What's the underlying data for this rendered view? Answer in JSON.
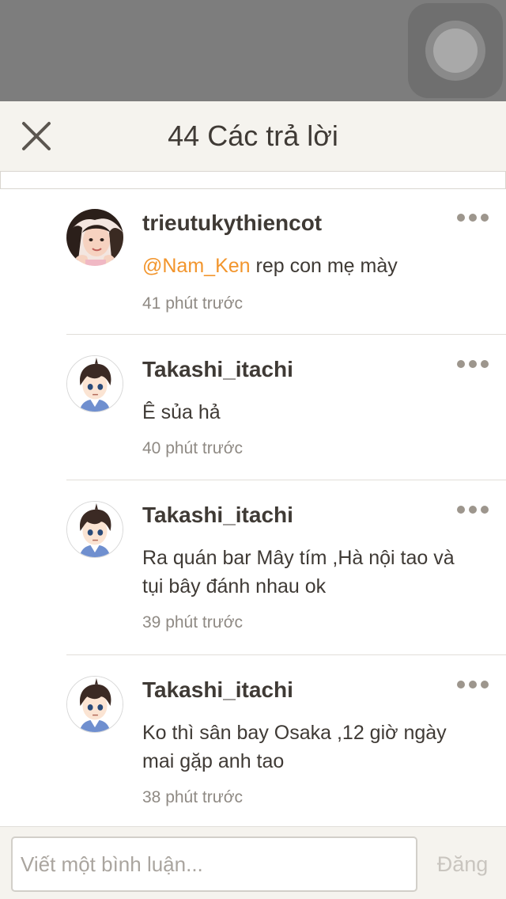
{
  "header": {
    "title": "44 Các trả lời",
    "close_icon": "close-icon"
  },
  "overlay": {
    "assistive_touch_icon": "assistive-touch-icon"
  },
  "comments": [
    {
      "username": "trieutukythiencot",
      "mention": "@Nam_Ken",
      "text": " rep con mẹ mày",
      "time": "41 phút trước",
      "avatar_icon": "girl-avatar"
    },
    {
      "username": "Takashi_itachi",
      "mention": "",
      "text": "Ê sủa hả",
      "time": "40 phút trước",
      "avatar_icon": "anime-boy-avatar"
    },
    {
      "username": "Takashi_itachi",
      "mention": "",
      "text": "Ra quán bar Mây tím ,Hà nội tao và tụi bây đánh nhau ok",
      "time": "39 phút trước",
      "avatar_icon": "anime-boy-avatar"
    },
    {
      "username": "Takashi_itachi",
      "mention": "",
      "text": "Ko thì sân bay Osaka ,12 giờ ngày mai gặp anh tao",
      "time": "38 phút trước",
      "avatar_icon": "anime-boy-avatar"
    }
  ],
  "footer": {
    "input_placeholder": "Viết một bình luận...",
    "input_value": "",
    "post_label": "Đăng"
  },
  "colors": {
    "mention": "#f2952c",
    "header_bg": "#f5f3ee",
    "text": "#3f3a35",
    "muted": "#8f8a84"
  }
}
